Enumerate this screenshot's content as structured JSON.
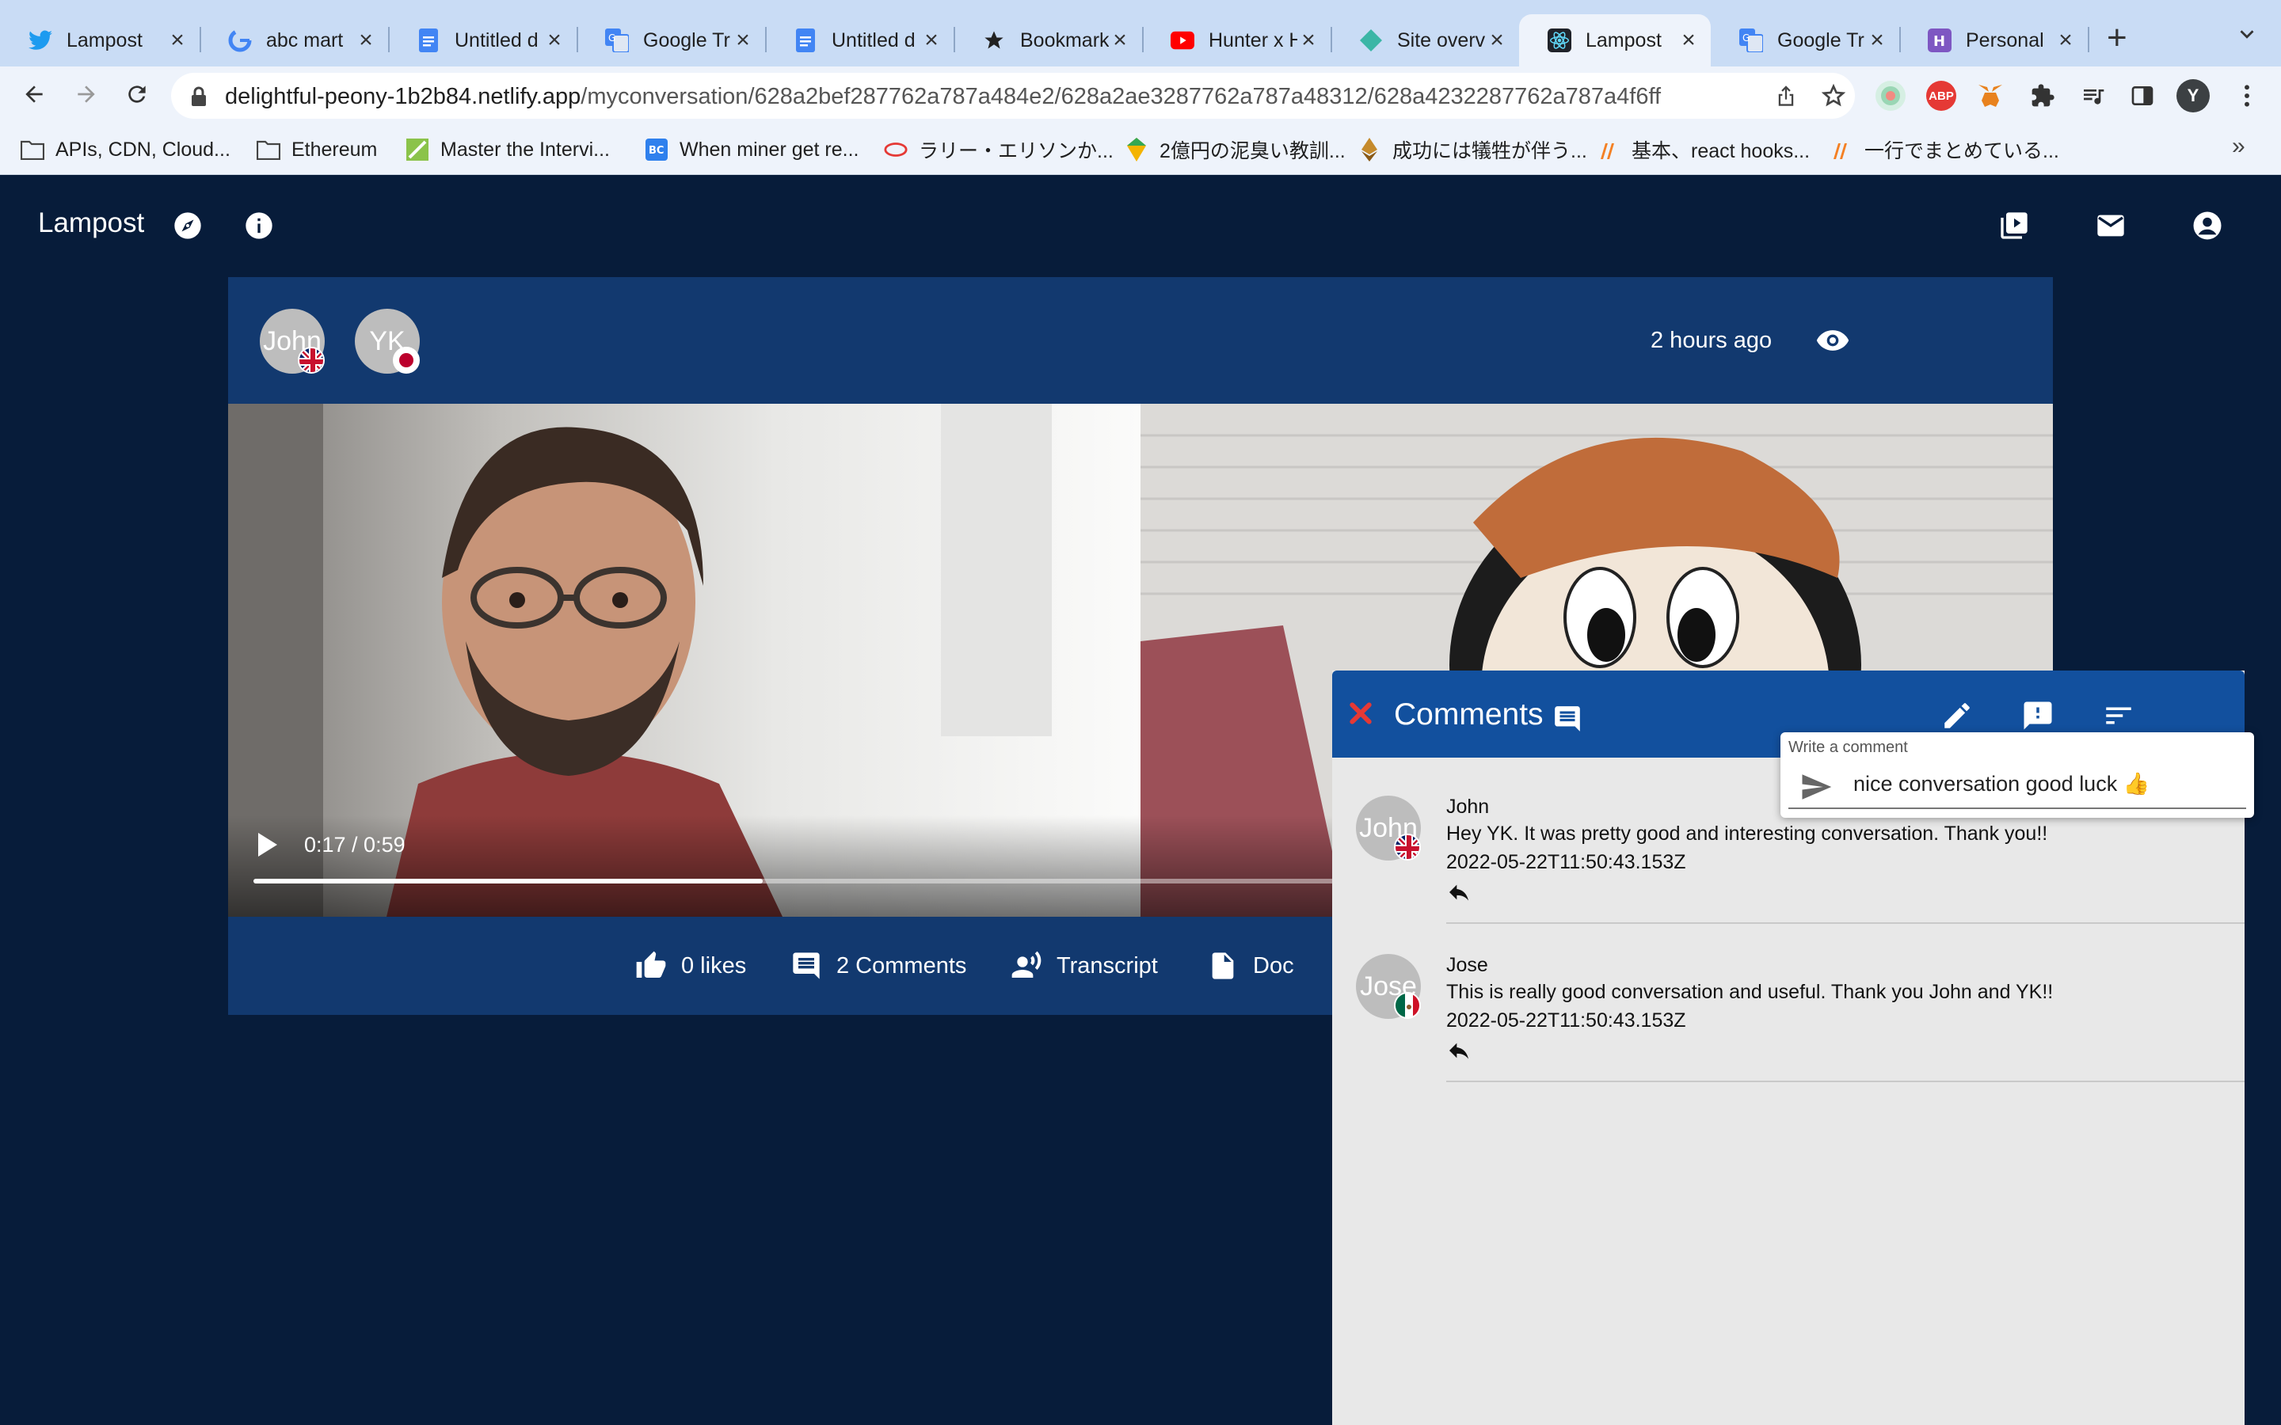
{
  "browser": {
    "tabs": [
      {
        "title": "Lampost",
        "icon": "twitter-icon"
      },
      {
        "title": "abc mart",
        "icon": "google-icon"
      },
      {
        "title": "Untitled d",
        "icon": "docs-icon"
      },
      {
        "title": "Google Tr",
        "icon": "translate-icon"
      },
      {
        "title": "Untitled d",
        "icon": "docs-icon"
      },
      {
        "title": "Bookmark",
        "icon": "star-icon"
      },
      {
        "title": "Hunter x H",
        "icon": "youtube-icon"
      },
      {
        "title": "Site overv",
        "icon": "netlify-icon"
      },
      {
        "title": "Lampost",
        "icon": "react-icon",
        "active": true
      },
      {
        "title": "Google Tr",
        "icon": "translate-icon"
      },
      {
        "title": "Personal",
        "icon": "hackmd-icon"
      }
    ],
    "url_host": "delightful-peony-1b2b84.netlify.app",
    "url_path": "/myconversation/628a2bef287762a787a484e2/628a2ae3287762a787a48312/628a4232287762a787a4f6ff",
    "profile_initial": "Y",
    "bookmarks": [
      {
        "label": "APIs, CDN, Cloud...",
        "icon": "folder-icon"
      },
      {
        "label": "Ethereum",
        "icon": "folder-icon"
      },
      {
        "label": "Master the Intervi...",
        "icon": "site-icon"
      },
      {
        "label": "When miner get re...",
        "icon": "site-icon"
      },
      {
        "label": "ラリー・エリソンか...",
        "icon": "site-icon"
      },
      {
        "label": "2億円の泥臭い教訓...",
        "icon": "site-icon"
      },
      {
        "label": "成功には犠牲が伴う...",
        "icon": "site-icon"
      },
      {
        "label": "基本、react hooks...",
        "icon": "site-icon"
      },
      {
        "label": "一行でまとめている...",
        "icon": "site-icon"
      }
    ],
    "bookmarks_more": "»"
  },
  "app": {
    "brand": "Lampost",
    "participants": [
      {
        "initials": "John",
        "flag": "uk"
      },
      {
        "initials": "YK",
        "flag": "jp"
      }
    ],
    "time_ago": "2 hours ago",
    "video": {
      "time": "0:17 / 0:59",
      "progress": 0.2883
    },
    "actions": {
      "likes": "0 likes",
      "comments": "2 Comments",
      "transcript": "Transcript",
      "doc": "Doc"
    }
  },
  "comments_panel": {
    "title": "Comments",
    "input_label": "Write a comment",
    "input_value": "nice conversation good luck 👍",
    "comments": [
      {
        "avatar": "John",
        "flag": "uk",
        "name": "John",
        "text": "Hey YK. It was pretty good and interesting conversation. Thank you!!",
        "date": "2022-05-22T11:50:43.153Z"
      },
      {
        "avatar": "Jose",
        "flag": "mx",
        "name": "Jose",
        "text": "This is really good conversation and useful. Thank you John and YK!!",
        "date": "2022-05-22T11:50:43.153Z"
      }
    ]
  },
  "colors": {
    "page_bg": "#071c3a",
    "card_bg": "#12396f",
    "panel_header": "#12509e",
    "panel_bg": "#e8e8e8",
    "close_red": "#e53935"
  }
}
